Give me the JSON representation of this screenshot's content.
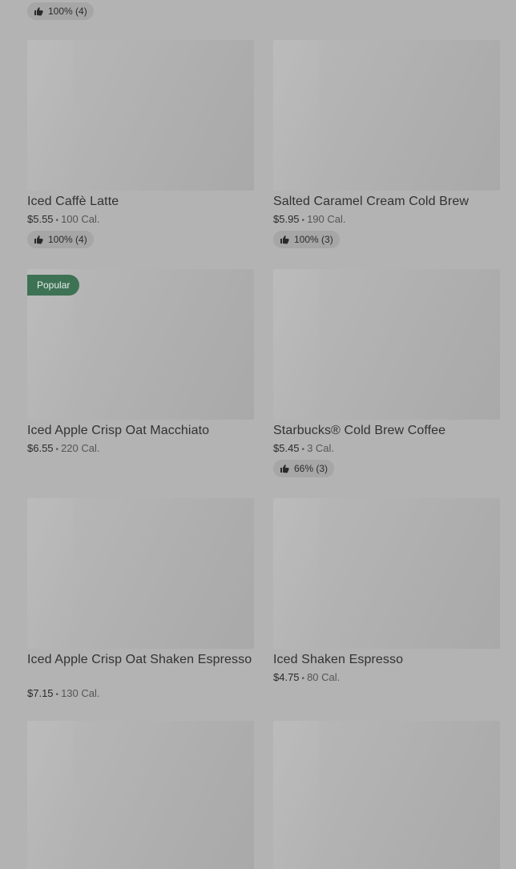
{
  "top_rating": {
    "label": "100% (4)"
  },
  "items": [
    {
      "title": "Iced Caffè Latte",
      "price": "$5.55",
      "calories": "100 Cal.",
      "rating": "100% (4)"
    },
    {
      "title": "Salted Caramel Cream Cold Brew",
      "price": "$5.95",
      "calories": "190 Cal.",
      "rating": "100% (3)"
    },
    {
      "title": "Iced Apple Crisp Oat Macchiato",
      "price": "$6.55",
      "calories": "220 Cal.",
      "badge": "Popular"
    },
    {
      "title": "Starbucks® Cold Brew Coffee",
      "price": "$5.45",
      "calories": "3 Cal.",
      "rating": "66% (3)"
    },
    {
      "title": "Iced Apple Crisp Oat Shaken Espresso",
      "price": "$7.15",
      "calories": "130 Cal."
    },
    {
      "title": "Iced Shaken Espresso",
      "price": "$4.75",
      "calories": "80 Cal."
    },
    {
      "title": "",
      "price": "",
      "calories": ""
    },
    {
      "title": "",
      "price": "",
      "calories": ""
    }
  ],
  "separator": "•",
  "icons": {
    "rating": "thumbs-up-icon"
  }
}
